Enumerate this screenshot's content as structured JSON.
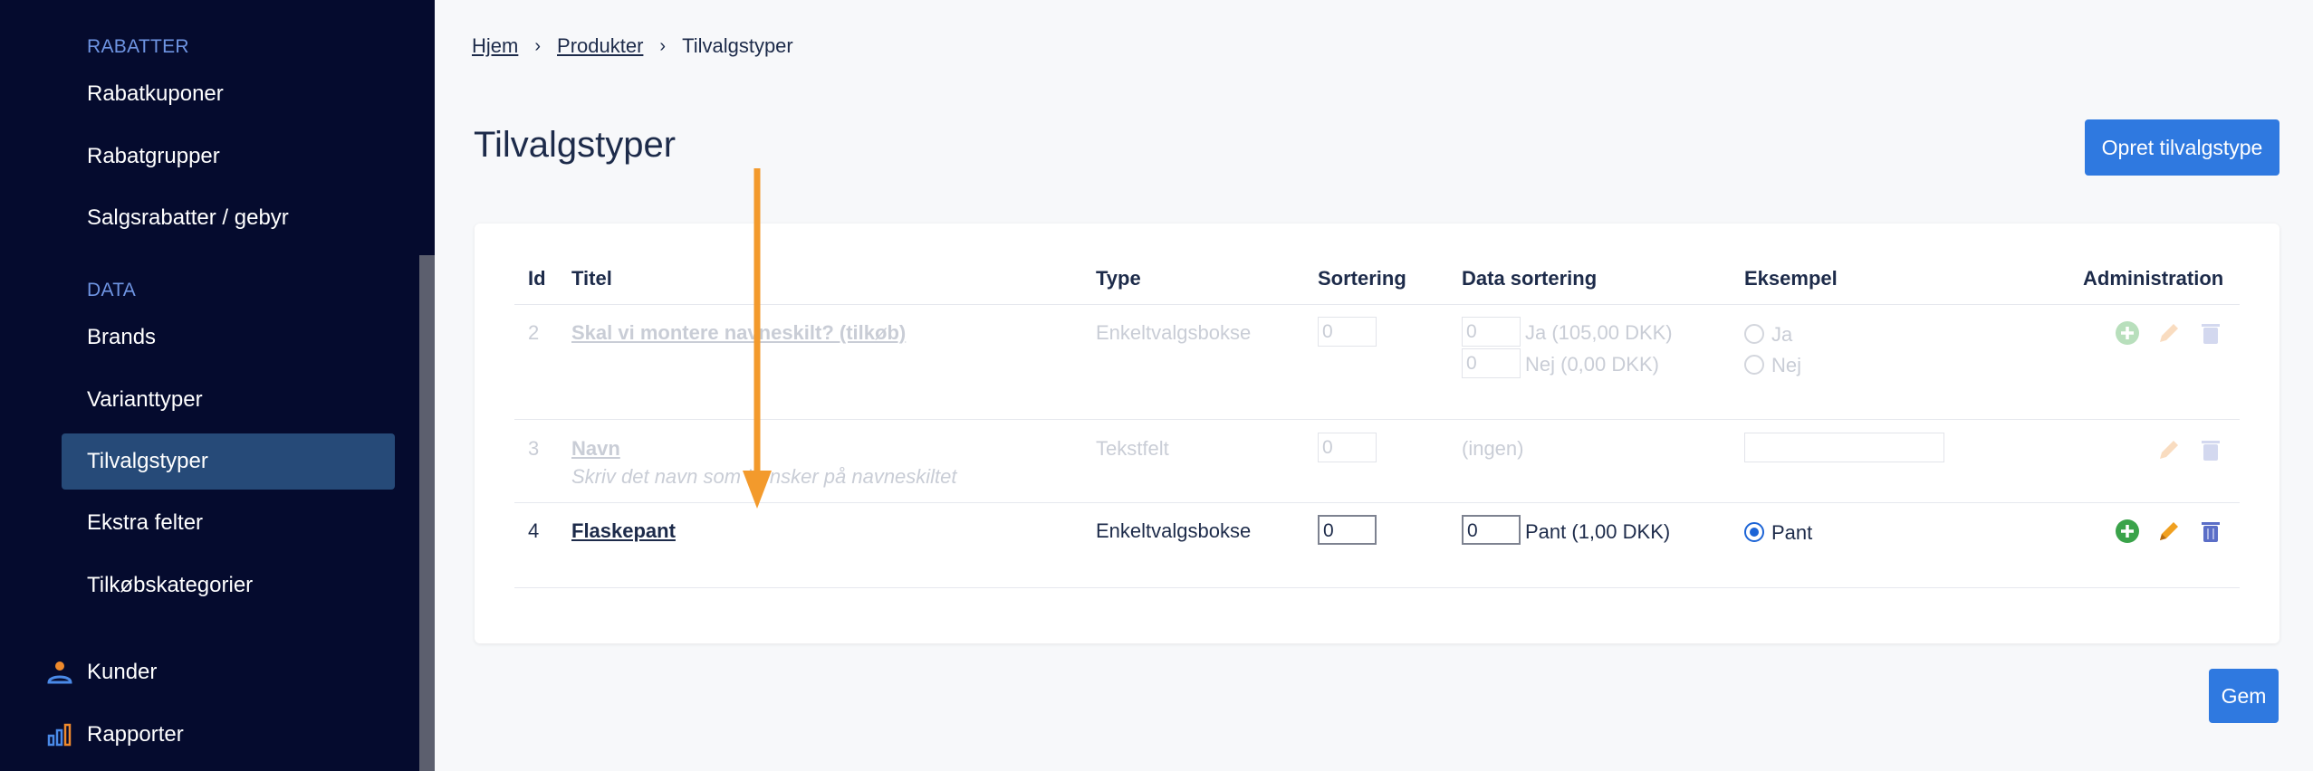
{
  "sidebar": {
    "sections": [
      {
        "label": "RABATTER"
      },
      {
        "label": "DATA"
      }
    ],
    "items": [
      {
        "label": "Rabatkuponer"
      },
      {
        "label": "Rabatgrupper"
      },
      {
        "label": "Salgsrabatter / gebyr"
      },
      {
        "label": "Brands"
      },
      {
        "label": "Varianttyper"
      },
      {
        "label": "Tilvalgstyper"
      },
      {
        "label": "Ekstra felter"
      },
      {
        "label": "Tilkøbskategorier"
      }
    ],
    "main_items": [
      {
        "label": "Kunder",
        "icon": "person-icon"
      },
      {
        "label": "Rapporter",
        "icon": "bar-chart-icon"
      }
    ]
  },
  "breadcrumb": {
    "items": [
      "Hjem",
      "Produkter",
      "Tilvalgstyper"
    ]
  },
  "page": {
    "title": "Tilvalgstyper",
    "create_button": "Opret tilvalgstype",
    "save_button": "Gem"
  },
  "table": {
    "headers": [
      "Id",
      "Titel",
      "Type",
      "Sortering",
      "Data sortering",
      "Eksempel",
      "Administration"
    ],
    "rows": [
      {
        "id": "2",
        "title": "Skal vi montere navneskilt? (tilkøb)",
        "subtitle": "",
        "type": "Enkeltvalgsbokse",
        "sort": "0",
        "data_sort": [
          {
            "value": "0",
            "label": "Ja (105,00 DKK)"
          },
          {
            "value": "0",
            "label": "Nej (0,00 DKK)"
          }
        ],
        "example": [
          "Ja",
          "Nej"
        ]
      },
      {
        "id": "3",
        "title": "Navn",
        "subtitle": "Skriv det navn som I ønsker på navneskiltet",
        "type": "Tekstfelt",
        "sort": "0",
        "data_sort_none": "(ingen)"
      },
      {
        "id": "4",
        "title": "Flaskepant",
        "type": "Enkeltvalgsbokse",
        "sort": "0",
        "data_sort": [
          {
            "value": "0",
            "label": "Pant (1,00 DKK)"
          }
        ],
        "example": [
          "Pant"
        ]
      }
    ]
  },
  "colors": {
    "sidebar_bg": "#050b2e",
    "active_item": "#264a78",
    "accent": "#2f79e0",
    "annotation_arrow": "#f39a2c",
    "add_icon": "#3aa34a",
    "edit_icon": "#f0a020",
    "delete_icon": "#5b6ec7"
  }
}
